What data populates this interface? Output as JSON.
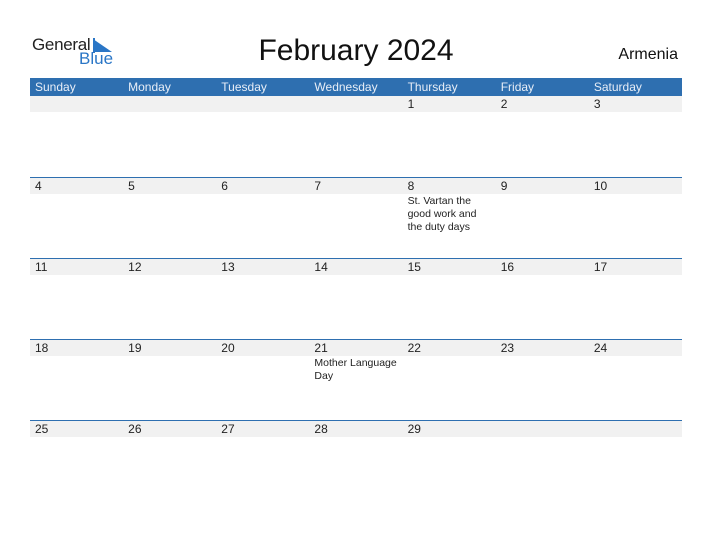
{
  "logo": {
    "part1": "General",
    "part2": "Blue"
  },
  "title": "February 2024",
  "country": "Armenia",
  "colors": {
    "header_bg": "#2e6fb0",
    "date_row_bg": "#f1f1f1",
    "brand_blue": "#2a76c6"
  },
  "weekdays": [
    "Sunday",
    "Monday",
    "Tuesday",
    "Wednesday",
    "Thursday",
    "Friday",
    "Saturday"
  ],
  "weeks": [
    {
      "days": [
        "",
        "",
        "",
        "",
        "1",
        "2",
        "3"
      ],
      "events": [
        "",
        "",
        "",
        "",
        "",
        "",
        ""
      ]
    },
    {
      "days": [
        "4",
        "5",
        "6",
        "7",
        "8",
        "9",
        "10"
      ],
      "events": [
        "",
        "",
        "",
        "",
        "St. Vartan the good work and the duty days",
        "",
        ""
      ]
    },
    {
      "days": [
        "11",
        "12",
        "13",
        "14",
        "15",
        "16",
        "17"
      ],
      "events": [
        "",
        "",
        "",
        "",
        "",
        "",
        ""
      ]
    },
    {
      "days": [
        "18",
        "19",
        "20",
        "21",
        "22",
        "23",
        "24"
      ],
      "events": [
        "",
        "",
        "",
        "Mother Language Day",
        "",
        "",
        ""
      ]
    },
    {
      "days": [
        "25",
        "26",
        "27",
        "28",
        "29",
        "",
        ""
      ],
      "events": [
        "",
        "",
        "",
        "",
        "",
        "",
        ""
      ]
    }
  ]
}
